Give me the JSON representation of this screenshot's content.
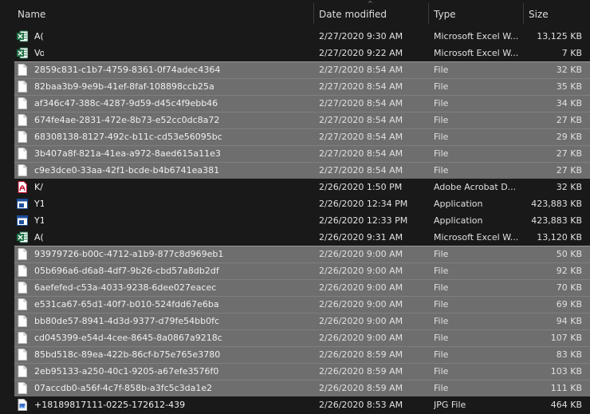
{
  "header": {
    "name": "Name",
    "date": "Date modified",
    "type": "Type",
    "size": "Size",
    "sort_glyph": "^"
  },
  "colors": {
    "background": "#191919",
    "selection": "#6e6e6e",
    "excel_green": "#1e7145",
    "acrobat_red": "#c8102e",
    "app_blue": "#1f4e9b"
  },
  "rows": [
    {
      "icon": "excel",
      "name": "A(",
      "date": "2/27/2020 9:30 AM",
      "type": "Microsoft Excel W...",
      "size": "13,125 KB",
      "selected": false
    },
    {
      "icon": "excel",
      "name": "Vo",
      "date": "2/27/2020 9:22 AM",
      "type": "Microsoft Excel W...",
      "size": "7 KB",
      "selected": false
    },
    {
      "icon": "file",
      "name": "2859c831-c1b7-4759-8361-0f74adec4364",
      "date": "2/27/2020 8:54 AM",
      "type": "File",
      "size": "32 KB",
      "selected": true
    },
    {
      "icon": "file",
      "name": "82baa3b9-9e9b-41ef-8faf-108898ccb25a",
      "date": "2/27/2020 8:54 AM",
      "type": "File",
      "size": "35 KB",
      "selected": true
    },
    {
      "icon": "file",
      "name": "af346c47-388c-4287-9d59-d45c4f9ebb46",
      "date": "2/27/2020 8:54 AM",
      "type": "File",
      "size": "34 KB",
      "selected": true
    },
    {
      "icon": "file",
      "name": "674fe4ae-2831-472e-8b73-e52cc0dc8a72",
      "date": "2/27/2020 8:54 AM",
      "type": "File",
      "size": "27 KB",
      "selected": true
    },
    {
      "icon": "file",
      "name": "68308138-8127-492c-b11c-cd53e56095bc",
      "date": "2/27/2020 8:54 AM",
      "type": "File",
      "size": "29 KB",
      "selected": true
    },
    {
      "icon": "file",
      "name": "3b407a8f-821a-41ea-a972-8aed615a11e3",
      "date": "2/27/2020 8:54 AM",
      "type": "File",
      "size": "27 KB",
      "selected": true
    },
    {
      "icon": "file",
      "name": "c9e3dce0-33aa-42f1-bcde-b4b6741ea381",
      "date": "2/27/2020 8:54 AM",
      "type": "File",
      "size": "27 KB",
      "selected": true
    },
    {
      "icon": "pdf",
      "name": "K/",
      "date": "2/26/2020 1:50 PM",
      "type": "Adobe Acrobat D...",
      "size": "32 KB",
      "selected": false
    },
    {
      "icon": "app",
      "name": "Y1",
      "date": "2/26/2020 12:34 PM",
      "type": "Application",
      "size": "423,883 KB",
      "selected": false
    },
    {
      "icon": "app",
      "name": "Y1",
      "date": "2/26/2020 12:33 PM",
      "type": "Application",
      "size": "423,883 KB",
      "selected": false
    },
    {
      "icon": "excel",
      "name": "A(",
      "date": "2/26/2020 9:31 AM",
      "type": "Microsoft Excel W...",
      "size": "13,120 KB",
      "selected": false
    },
    {
      "icon": "file",
      "name": "93979726-b00c-4712-a1b9-877c8d969eb1",
      "date": "2/26/2020 9:00 AM",
      "type": "File",
      "size": "50 KB",
      "selected": true
    },
    {
      "icon": "file",
      "name": "05b696a6-d6a8-4df7-9b26-cbd57a8db2df",
      "date": "2/26/2020 9:00 AM",
      "type": "File",
      "size": "92 KB",
      "selected": true
    },
    {
      "icon": "file",
      "name": "6aefefed-c53a-4033-9238-6dee027eacec",
      "date": "2/26/2020 9:00 AM",
      "type": "File",
      "size": "70 KB",
      "selected": true
    },
    {
      "icon": "file",
      "name": "e531ca67-65d1-40f7-b010-524fdd67e6ba",
      "date": "2/26/2020 9:00 AM",
      "type": "File",
      "size": "69 KB",
      "selected": true
    },
    {
      "icon": "file",
      "name": "bb80de57-8941-4d3d-9377-d79fe54bb0fc",
      "date": "2/26/2020 9:00 AM",
      "type": "File",
      "size": "94 KB",
      "selected": true
    },
    {
      "icon": "file",
      "name": "cd045399-e54d-4cee-8645-8a0867a9218c",
      "date": "2/26/2020 9:00 AM",
      "type": "File",
      "size": "107 KB",
      "selected": true
    },
    {
      "icon": "file",
      "name": "85bd518c-89ea-422b-86cf-b75e765e3780",
      "date": "2/26/2020 8:59 AM",
      "type": "File",
      "size": "83 KB",
      "selected": true
    },
    {
      "icon": "file",
      "name": "2eb95133-a250-40c1-9205-a67efe3576f0",
      "date": "2/26/2020 8:59 AM",
      "type": "File",
      "size": "103 KB",
      "selected": true
    },
    {
      "icon": "file",
      "name": "07accdb0-a56f-4c7f-858b-a3fc5c3da1e2",
      "date": "2/26/2020 8:59 AM",
      "type": "File",
      "size": "111 KB",
      "selected": true
    },
    {
      "icon": "jpg",
      "name": "+18189817111-0225-172612-439",
      "date": "2/26/2020 8:53 AM",
      "type": "JPG File",
      "size": "464 KB",
      "selected": false
    }
  ]
}
